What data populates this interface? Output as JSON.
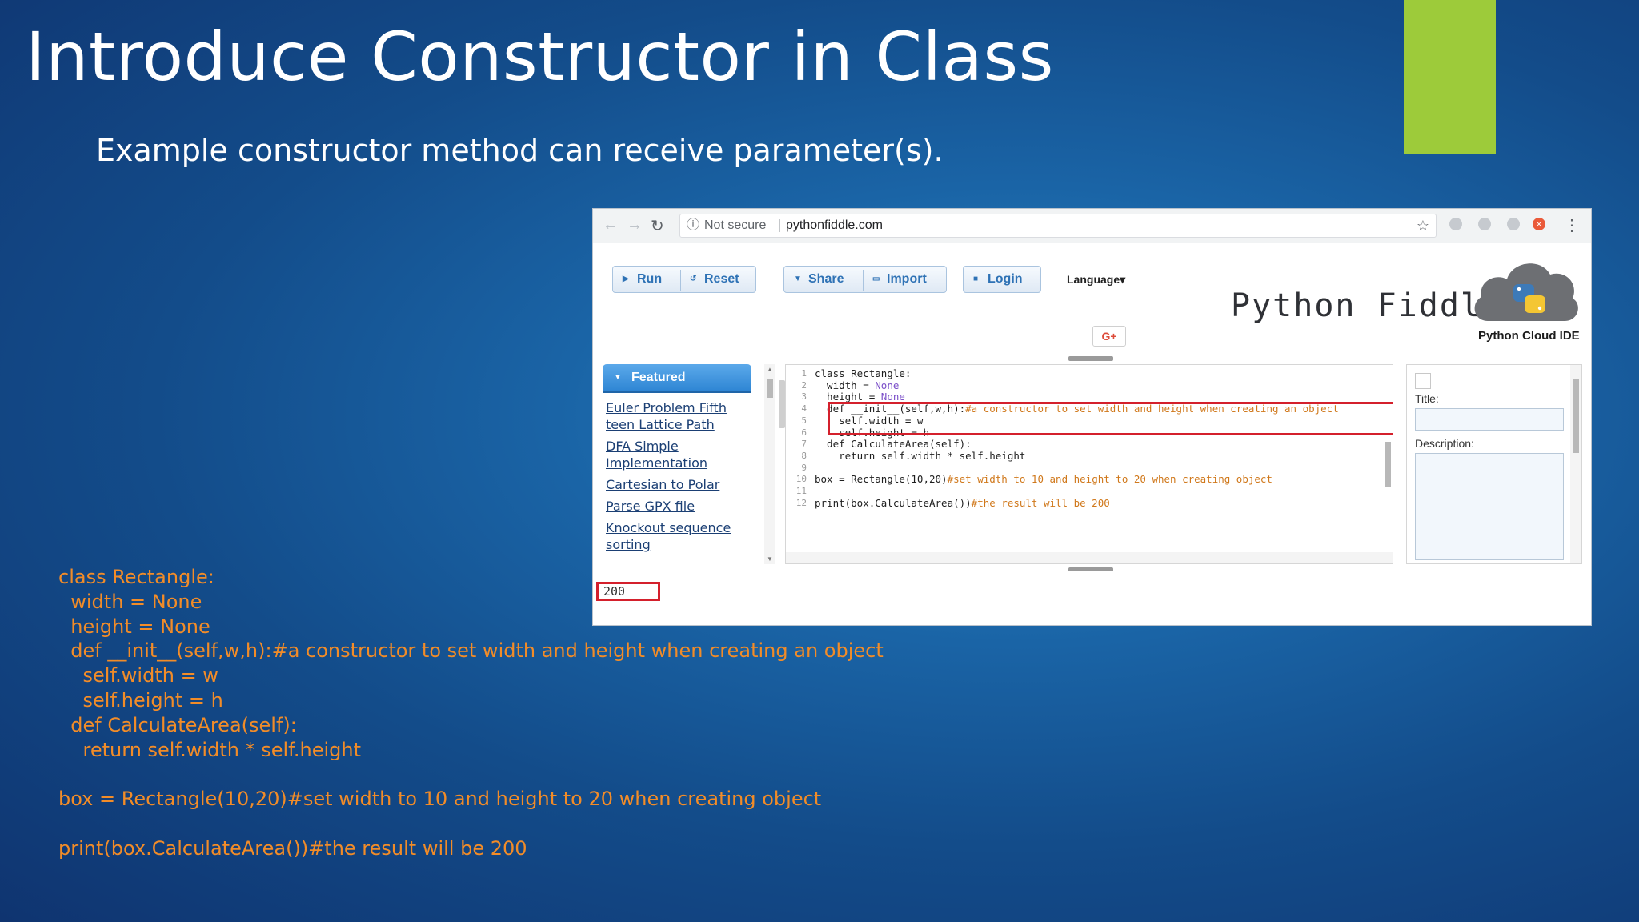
{
  "slide": {
    "title": "Introduce Constructor in Class",
    "subtitle": "Example constructor method can receive parameter(s).",
    "accent_color": "#9dcb3a",
    "code_color": "#f28c28",
    "code_lines": [
      "class Rectangle:",
      "  width = None",
      "  height = None",
      "  def __init__(self,w,h):#a constructor to set width and height when creating an object",
      "    self.width = w",
      "    self.height = h",
      "  def CalculateArea(self):",
      "    return self.width * self.height",
      "",
      "box = Rectangle(10,20)#set width to 10 and height to 20 when creating object",
      "",
      "print(box.CalculateArea())#the result will be 200"
    ]
  },
  "browser": {
    "security_label": "Not secure",
    "url": "pythonfiddle.com",
    "icons": [
      "back-icon",
      "forward-icon",
      "reload-icon",
      "info-icon",
      "star-icon",
      "menu-icon"
    ],
    "toolbar": {
      "run_label": "Run",
      "reset_label": "Reset",
      "share_label": "Share",
      "import_label": "Import",
      "login_label": "Login",
      "language_label": "Language▾",
      "gplus_label": "G+"
    },
    "brand": {
      "title": "Python Fiddle",
      "tagline": "Python Cloud IDE"
    },
    "sidebar": {
      "featured_label": "Featured",
      "samples": [
        "Euler Problem Fifth teen Lattice Path",
        "DFA Simple Implementation",
        "Cartesian to Polar",
        "Parse GPX file",
        "Knockout sequence sorting"
      ]
    },
    "editor": {
      "line_numbers": [
        "1",
        "2",
        "3",
        "4",
        "5",
        "6",
        "7",
        "8",
        "9",
        "10",
        "11",
        "12"
      ],
      "lines": [
        {
          "code": "class Rectangle:",
          "comment": ""
        },
        {
          "code": "  width = ",
          "none": "None",
          "comment": ""
        },
        {
          "code": "  height = ",
          "none": "None",
          "comment": ""
        },
        {
          "code": "  def __init__(self,w,h):",
          "comment": "#a constructor to set width and height when creating an object"
        },
        {
          "code": "    self.width = w",
          "comment": ""
        },
        {
          "code": "    self.height = h",
          "comment": ""
        },
        {
          "code": "  def CalculateArea(self):",
          "comment": ""
        },
        {
          "code": "    return self.width * self.height",
          "comment": ""
        },
        {
          "code": "",
          "comment": ""
        },
        {
          "code": "box = Rectangle(10,20)",
          "comment": "#set width to 10 and height to 20 when creating object"
        },
        {
          "code": "",
          "comment": ""
        },
        {
          "code": "print(box.CalculateArea())",
          "comment": "#the result will be 200"
        }
      ]
    },
    "meta": {
      "title_label": "Title:",
      "description_label": "Description:"
    },
    "output": {
      "value": "200"
    },
    "highlight_color": "#d4202c"
  }
}
